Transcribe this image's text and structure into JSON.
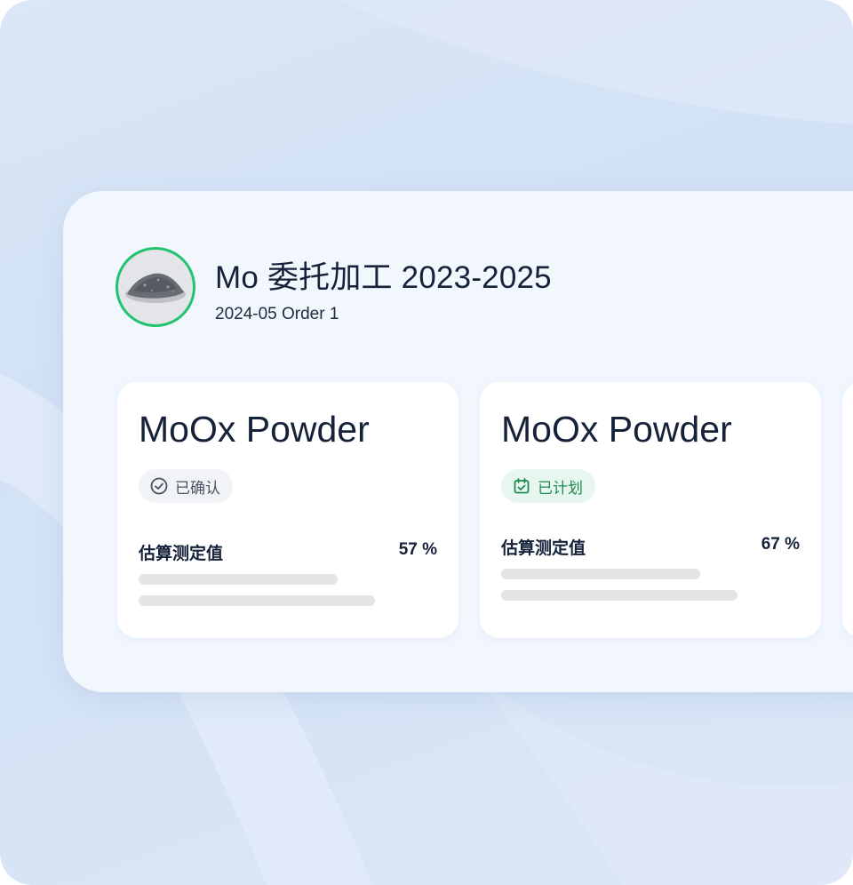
{
  "project": {
    "title": "Mo 委托加工 2023-2025",
    "subtitle": "2024-05 Order 1",
    "avatar_icon": "powder-pile-image"
  },
  "cards": [
    {
      "name": "MoOx Powder",
      "status": {
        "label": "已确认",
        "icon": "check-circle-icon",
        "color": "#4a5261"
      },
      "metric": {
        "label": "估算测定值",
        "value": "57 %"
      }
    },
    {
      "name": "MoOx Powder",
      "status": {
        "label": "已计划",
        "icon": "calendar-check-icon",
        "color": "#1e8a4f"
      },
      "metric": {
        "label": "估算测定值",
        "value": "67 %"
      }
    }
  ],
  "colors": {
    "accent_green": "#22c36f",
    "text_dark": "#16223a",
    "panel_bg": "#f2f7fe",
    "page_bg": "#d2e1f5"
  }
}
